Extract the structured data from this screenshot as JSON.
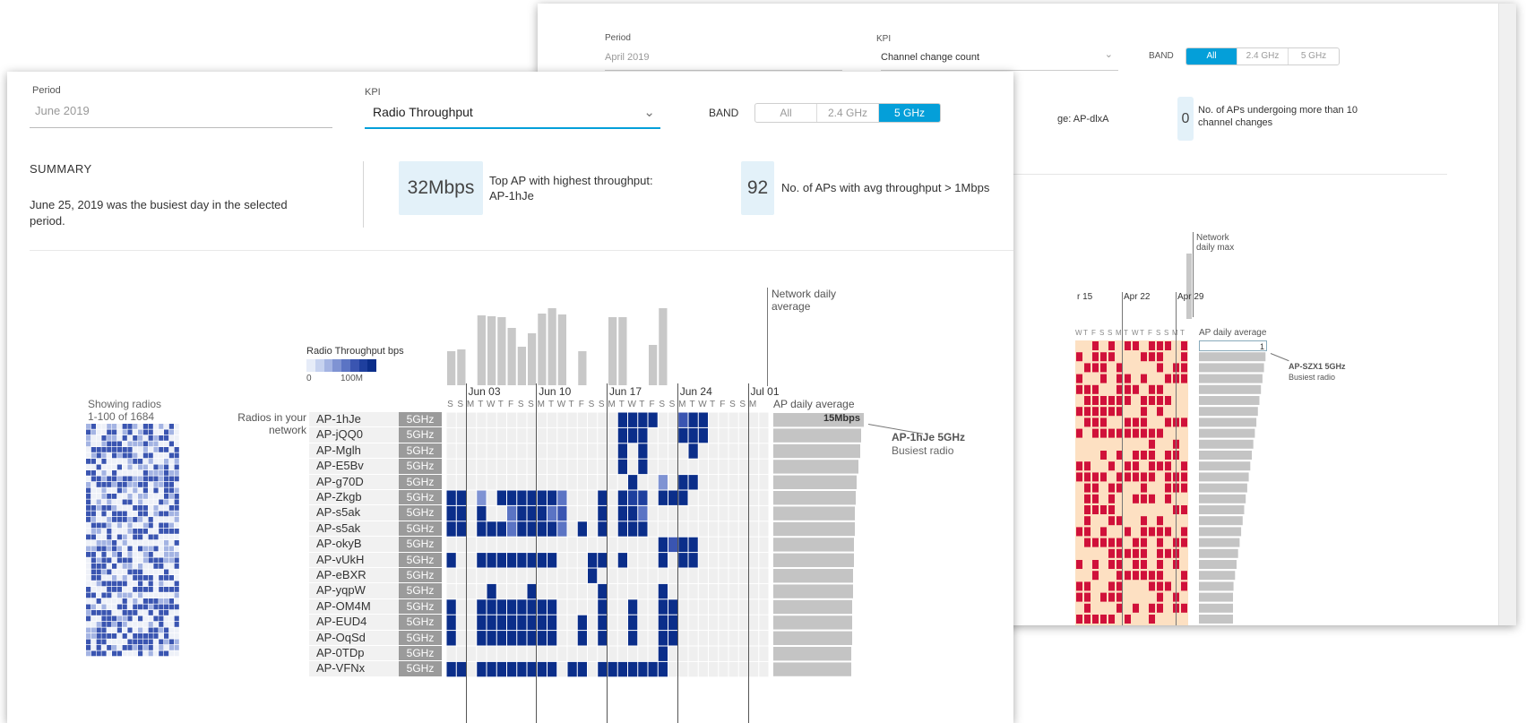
{
  "back": {
    "period_label": "Period",
    "period_value": "April 2019",
    "kpi_label": "KPI",
    "kpi_value": "Channel change count",
    "band_label": "BAND",
    "band_options": [
      "All",
      "2.4 GHz",
      "5 GHz"
    ],
    "band_selected": 0,
    "top_ap_text": "ge: AP-dlxA",
    "stat_value": "0",
    "stat_text": "No. of APs undergoing more than 10 channel changes",
    "network_max_label": "Network daily max",
    "week_labels": [
      "r 15",
      "Apr 22",
      "Apr 29"
    ],
    "day_letters": "WTFSSMTWTFSSMT",
    "ap_daily_avg_label": "AP daily average",
    "top_bar_value": "1",
    "busiest_name": "AP-SZX1 5GHz",
    "busiest_label": "Busiest radio"
  },
  "front": {
    "period_label": "Period",
    "period_value": "June 2019",
    "kpi_label": "KPI",
    "kpi_value": "Radio Throughput",
    "band_label": "BAND",
    "band_options": [
      "All",
      "2.4 GHz",
      "5 GHz"
    ],
    "band_selected": 2,
    "summary_heading": "SUMMARY",
    "summary_text": "June 25, 2019 was the busiest day in the selected period.",
    "stat1_value": "32Mbps",
    "stat1_text": "Top AP with highest throughput: AP-1hJe",
    "stat2_value": "92",
    "stat2_text": "No. of APs with avg throughput > 1Mbps",
    "network_avg_label": "Network daily average",
    "legend_title": "Radio Throughput bps",
    "legend_min": "0",
    "legend_max": "100M",
    "legend_colors": [
      "#e6ecf8",
      "#c6d2ef",
      "#a4b4e3",
      "#7f93d3",
      "#5b74c4",
      "#3a55b1",
      "#1e3f9e",
      "#0b2e8a"
    ],
    "showing_label": "Showing radios",
    "showing_range": "1-100 of 1684",
    "radios_label": "Radios in your network",
    "week_labels": [
      "Jun 03",
      "Jun 10",
      "Jun 17",
      "Jun 24",
      "Jul 01"
    ],
    "day_letters": "SSMTWTFSSMTWTFSSMTWTFSSMTWTFSSM",
    "ap_daily_avg_label": "AP daily average",
    "top_bar_value": "15Mbps",
    "busiest_name": "AP-1hJe 5GHz",
    "busiest_label": "Busiest radio",
    "rows": [
      {
        "name": "AP-1hJe",
        "band": "5GHz"
      },
      {
        "name": "AP-jQQ0",
        "band": "5GHz"
      },
      {
        "name": "AP-Mglh",
        "band": "5GHz"
      },
      {
        "name": "AP-E5Bv",
        "band": "5GHz"
      },
      {
        "name": "AP-g70D",
        "band": "5GHz"
      },
      {
        "name": "AP-Zkgb",
        "band": "5GHz"
      },
      {
        "name": "AP-s5ak",
        "band": "5GHz"
      },
      {
        "name": "AP-s5ak",
        "band": "5GHz"
      },
      {
        "name": "AP-okyB",
        "band": "5GHz"
      },
      {
        "name": "AP-vUkH",
        "band": "5GHz"
      },
      {
        "name": "AP-eBXR",
        "band": "5GHz"
      },
      {
        "name": "AP-yqpW",
        "band": "5GHz"
      },
      {
        "name": "AP-OM4M",
        "band": "5GHz"
      },
      {
        "name": "AP-EUD4",
        "band": "5GHz"
      },
      {
        "name": "AP-OqSd",
        "band": "5GHz"
      },
      {
        "name": "AP-0TDp",
        "band": "5GHz"
      },
      {
        "name": "AP-VFNx",
        "band": "5GHz"
      }
    ]
  }
}
